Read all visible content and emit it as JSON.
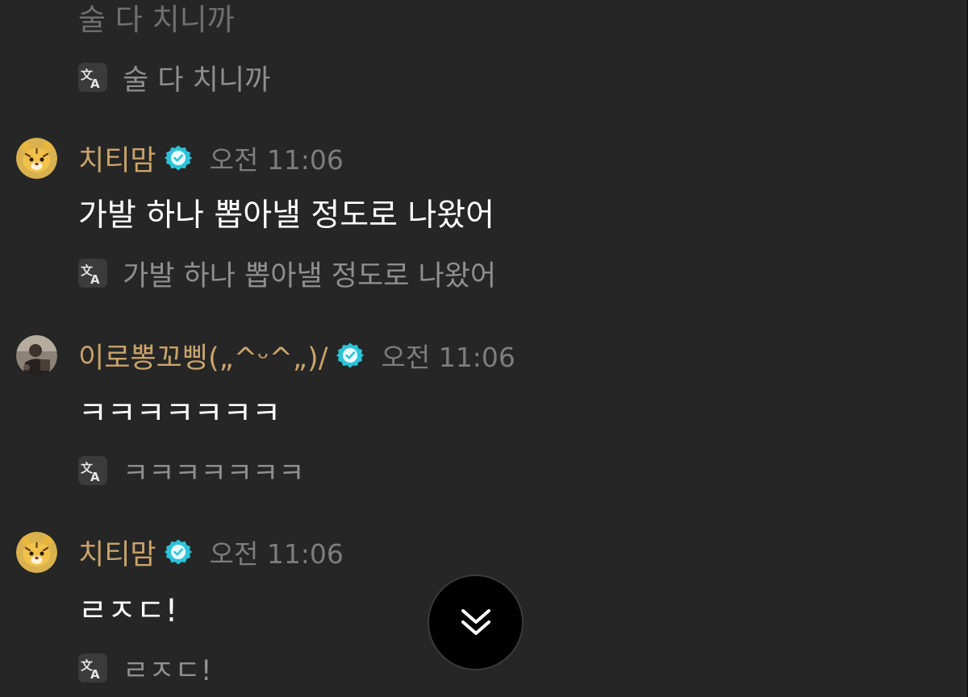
{
  "partial_message": {
    "text": "술 다 치니까",
    "translation": "술 다 치니까"
  },
  "messages": [
    {
      "username": "치티맘",
      "time": "오전 11:06",
      "text": "가발 하나 뽑아낼 정도로 나왔어",
      "translation": "가발 하나 뽑아낼 정도로 나왔어",
      "avatar_icon": "tiger-avatar-icon",
      "verified_icon": "verified-badge-icon"
    },
    {
      "username": "이로뽕꼬삥(„^ᵕ^„)/",
      "time": "오전 11:06",
      "text": "ㅋㅋㅋㅋㅋㅋㅋ",
      "translation": "ㅋㅋㅋㅋㅋㅋㅋ",
      "avatar_icon": "photo-avatar-icon",
      "verified_icon": "verified-badge-icon"
    },
    {
      "username": "치티맘",
      "time": "오전 11:06",
      "text": "ㄹㅈㄷ!",
      "translation": "ㄹㅈㄷ!",
      "avatar_icon": "tiger-avatar-icon",
      "verified_icon": "verified-badge-icon"
    }
  ],
  "icons": {
    "translate": "translate-icon",
    "scroll_down": "double-chevron-down-icon"
  },
  "colors": {
    "background": "#262626",
    "username": "#c9a36a",
    "timestamp": "#7d7d7d",
    "message_text": "#ffffff",
    "translation_text": "#8f8f8f",
    "verified_badge": "#2bc4d8",
    "scroll_button": "#000000"
  }
}
